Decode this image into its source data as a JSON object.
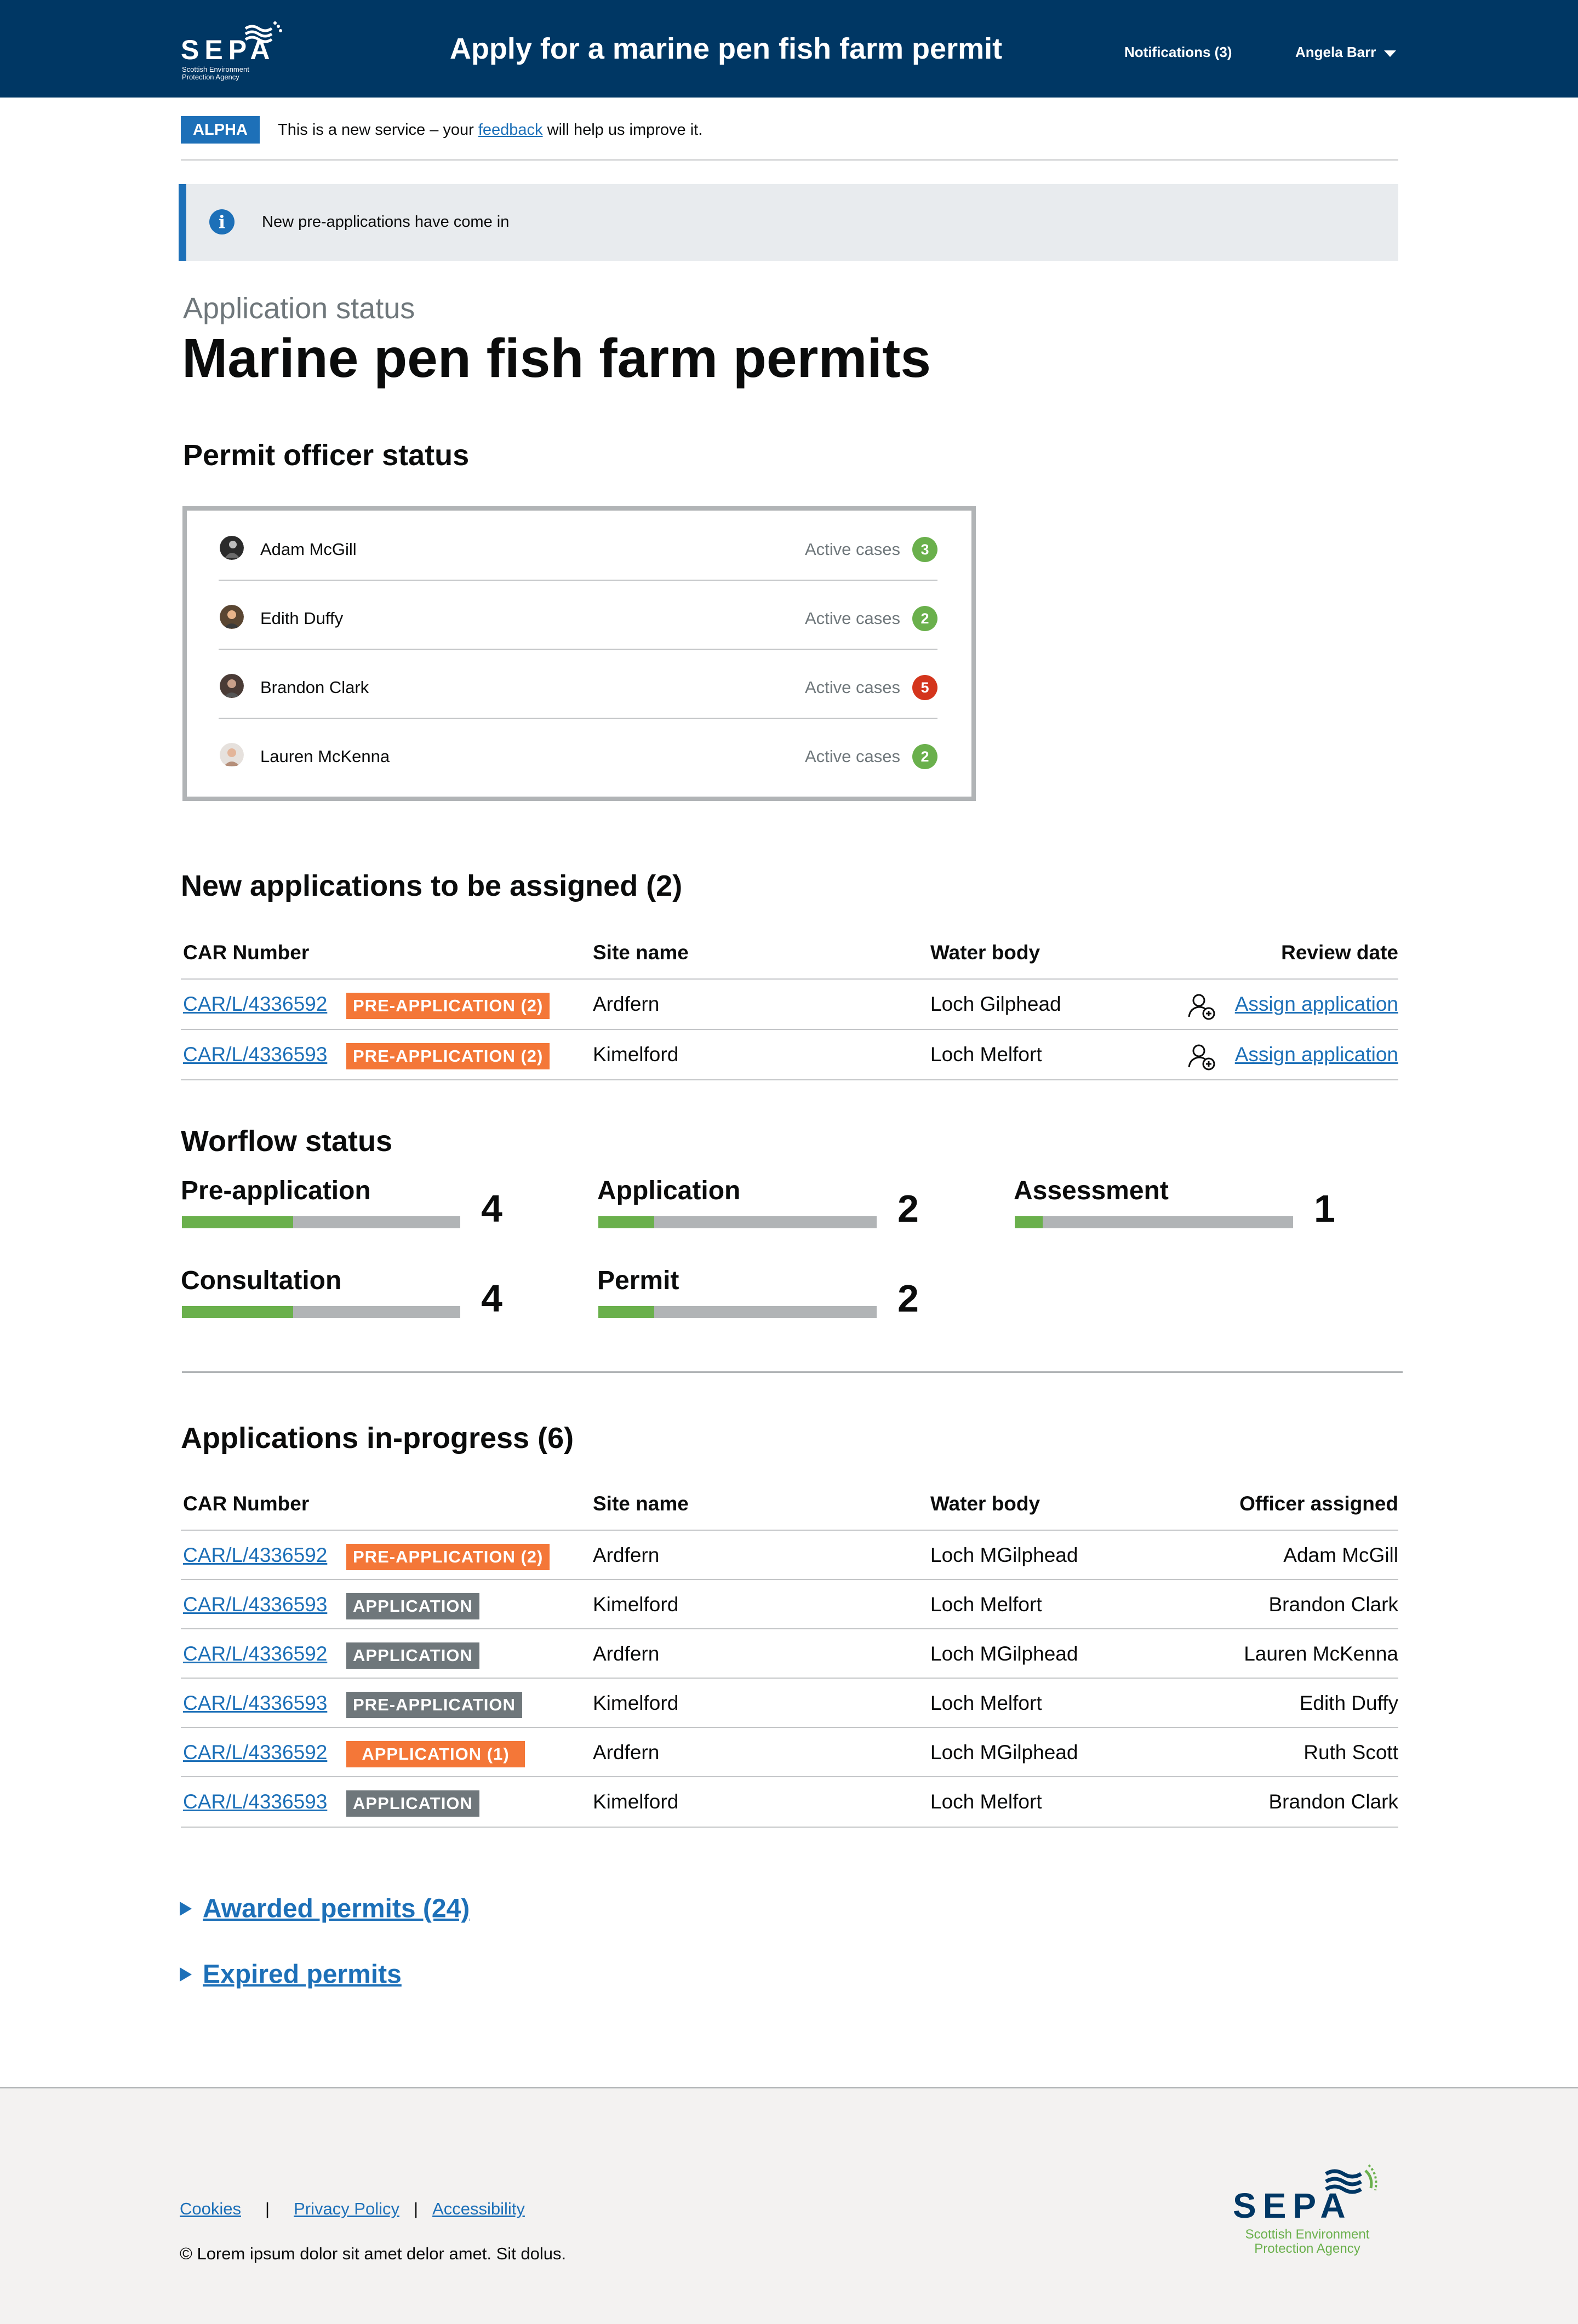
{
  "header": {
    "logo_letters": "SEPA",
    "logo_subtitle": "Scottish Environment Protection Agency",
    "service_title": "Apply for a marine pen fish farm permit",
    "notifications": "Notifications (3)",
    "user_name": "Angela Barr"
  },
  "phase_banner": {
    "tag": "ALPHA",
    "text_before": "This is a new service – your ",
    "link": "feedback",
    "text_after": " will help us improve it."
  },
  "notification": {
    "text": "New pre-applications have come in"
  },
  "page": {
    "caption": "Application status",
    "title": "Marine pen fish farm permits"
  },
  "officers": {
    "heading": "Permit officer status",
    "label": "Active cases",
    "items": [
      {
        "name": "Adam McGill",
        "count": "3",
        "status": "ok"
      },
      {
        "name": "Edith Duffy",
        "count": "2",
        "status": "ok"
      },
      {
        "name": "Brandon Clark",
        "count": "5",
        "status": "over"
      },
      {
        "name": "Lauren McKenna",
        "count": "2",
        "status": "ok"
      }
    ]
  },
  "new_applications": {
    "heading": "New applications to be assigned (2)",
    "columns": [
      "CAR Number",
      "Site name",
      "Water body",
      "Review date"
    ],
    "action_label": "Assign application",
    "rows": [
      {
        "car": "CAR/L/4336592",
        "tag": "PRE-APPLICATION (2)",
        "site": "Ardfern",
        "water": "Loch Gilphead"
      },
      {
        "car": "CAR/L/4336593",
        "tag": "PRE-APPLICATION (2)",
        "site": "Kimelford",
        "water": "Loch Melfort"
      }
    ]
  },
  "workflow": {
    "heading": "Worflow status",
    "items": [
      {
        "label": "Pre-application",
        "count": "4",
        "progress": 0.4
      },
      {
        "label": "Application",
        "count": "2",
        "progress": 0.2
      },
      {
        "label": "Assessment",
        "count": "1",
        "progress": 0.1
      },
      {
        "label": "Consultation",
        "count": "4",
        "progress": 0.4
      },
      {
        "label": "Permit",
        "count": "2",
        "progress": 0.2
      }
    ]
  },
  "in_progress": {
    "heading": "Applications in-progress (6)",
    "columns": [
      "CAR Number",
      "Site name",
      "Water body",
      "Officer assigned"
    ],
    "rows": [
      {
        "car": "CAR/L/4336592",
        "tag": "PRE-APPLICATION (2)",
        "tag_color": "#f47738",
        "site": "Ardfern",
        "water": "Loch MGilphead",
        "officer": "Adam McGill"
      },
      {
        "car": "CAR/L/4336593",
        "tag": "APPLICATION",
        "tag_color": "#6f777b",
        "site": "Kimelford",
        "water": "Loch Melfort",
        "officer": "Brandon Clark"
      },
      {
        "car": "CAR/L/4336592",
        "tag": "APPLICATION",
        "tag_color": "#6f777b",
        "site": "Ardfern",
        "water": "Loch MGilphead",
        "officer": "Lauren McKenna"
      },
      {
        "car": "CAR/L/4336593",
        "tag": "PRE-APPLICATION",
        "tag_color": "#6f777b",
        "site": "Kimelford",
        "water": "Loch Melfort",
        "officer": "Edith Duffy"
      },
      {
        "car": "CAR/L/4336592",
        "tag": "APPLICATION (1)",
        "tag_color": "#f47738",
        "site": "Ardfern",
        "water": "Loch MGilphead",
        "officer": "Ruth Scott"
      },
      {
        "car": "CAR/L/4336593",
        "tag": "APPLICATION",
        "tag_color": "#6f777b",
        "site": "Kimelford",
        "water": "Loch Melfort",
        "officer": "Brandon Clark"
      }
    ]
  },
  "details": {
    "awarded": "Awarded permits (24)",
    "expired": "Expired permits"
  },
  "footer": {
    "links": [
      "Cookies",
      "Privacy Policy",
      "Accessibility"
    ],
    "copyright": "© Lorem ipsum dolor sit amet delor amet. Sit dolus.",
    "logo_letters": "SEPA",
    "logo_subtitle": "Scottish Environment Protection Agency"
  },
  "colors": {
    "header_bg": "#003764",
    "link": "#1d70b8",
    "tag_orange": "#f47738",
    "tag_grey": "#6f777b",
    "count_ok": "#6ab04c",
    "count_over": "#d4351c",
    "progress_fill": "#6ab04c",
    "progress_track": "#b1b4b6"
  },
  "icons": {
    "info": "info-icon",
    "assign": "assign-user-icon",
    "expand": "triangle-right-icon",
    "user_menu": "caret-down-icon"
  }
}
